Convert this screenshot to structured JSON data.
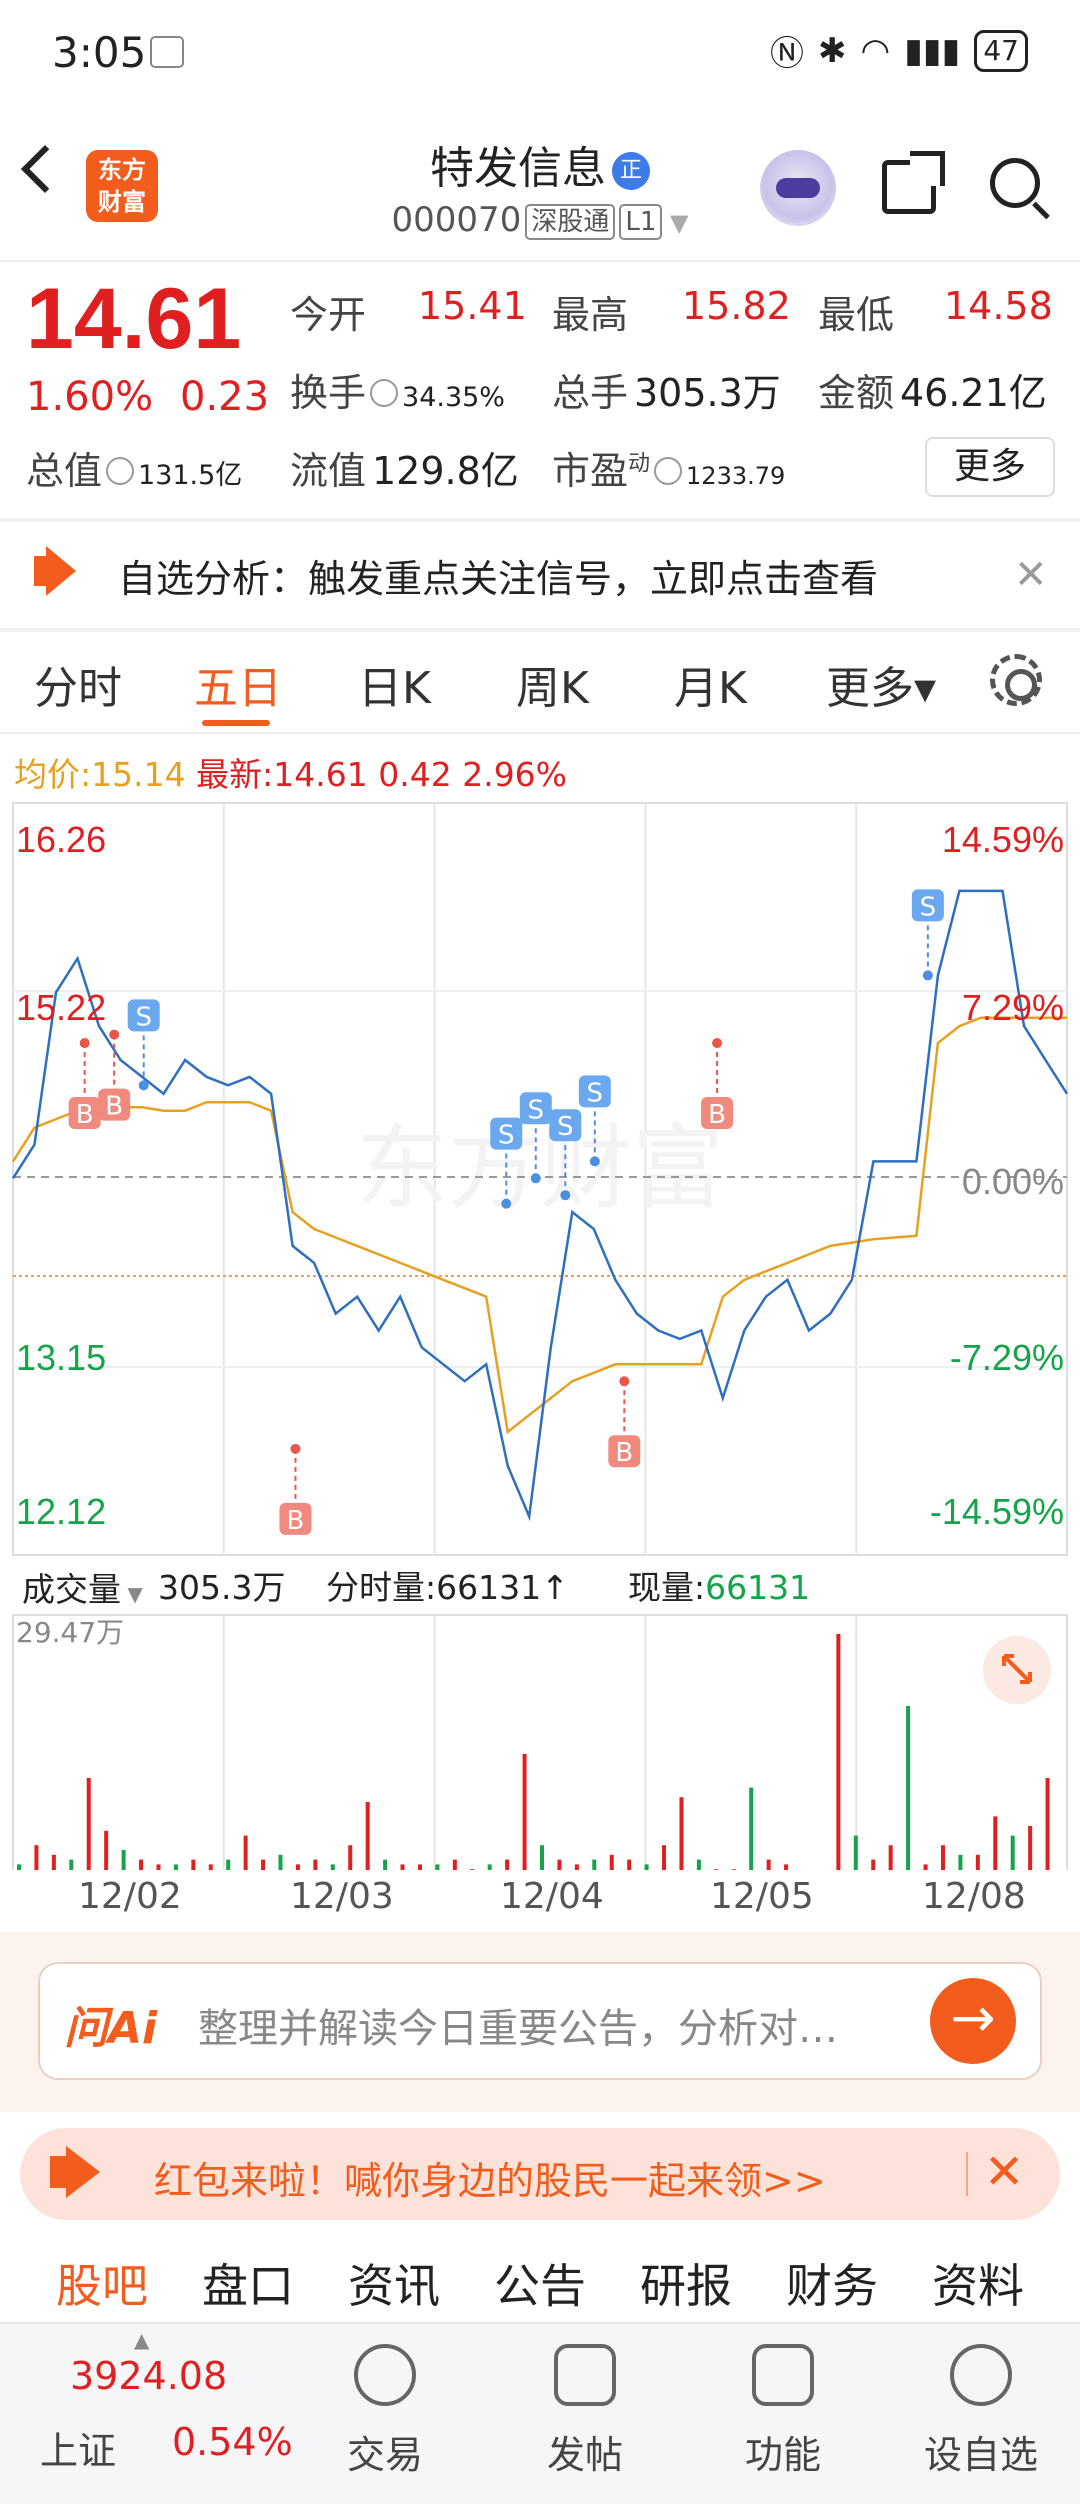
{
  "status_bar": {
    "time": "3:05",
    "battery": "47"
  },
  "header": {
    "logo_line1": "东方",
    "logo_line2": "财富",
    "stock_name": "特发信息",
    "name_badge": "正",
    "stock_code": "000070",
    "tag_connect": "深股通",
    "tag_level": "L1"
  },
  "quote": {
    "price": "14.61",
    "change_pct": "1.60%",
    "change": "0.23",
    "open_label": "今开",
    "open": "15.41",
    "high_label": "最高",
    "high": "15.82",
    "low_label": "最低",
    "low": "14.58",
    "turnover_label": "换手",
    "turnover": "34.35%",
    "volume_label": "总手",
    "volume": "305.3万",
    "amount_label": "金额",
    "amount": "46.21亿",
    "mktcap_label": "总值",
    "mktcap": "131.5亿",
    "float_label": "流值",
    "float": "129.8亿",
    "pe_label": "市盈",
    "pe_sup": "动",
    "pe": "1233.79",
    "more_label": "更多"
  },
  "notice": {
    "text": "自选分析：触发重点关注信号，立即点击查看",
    "close": "✕"
  },
  "tabs": [
    "分时",
    "五日",
    "日K",
    "周K",
    "月K",
    "更多▾"
  ],
  "avg_line": {
    "avg_label": "均价:",
    "avg": "15.14",
    "latest_label": "最新:",
    "latest": "14.61",
    "diff": "0.42",
    "pct": "2.96%"
  },
  "chart_data": {
    "type": "line",
    "title": "",
    "x": [
      "12/02",
      "12/03",
      "12/04",
      "12/05",
      "12/08"
    ],
    "y_labels_left": [
      "16.26",
      "15.22",
      "13.15",
      "12.12"
    ],
    "y_labels_right": [
      "14.59%",
      "7.29%",
      "0.00%",
      "-7.29%",
      "-14.59%"
    ],
    "ylim": [
      12.12,
      16.26
    ],
    "prev_close_label": "0.00%",
    "watermark": "东方财富",
    "signals": [
      {
        "label": "B",
        "day": "12/02",
        "price": 15.0
      },
      {
        "label": "B",
        "day": "12/02",
        "price": 15.05
      },
      {
        "label": "S",
        "day": "12/02",
        "price": 14.75
      },
      {
        "label": "B",
        "day": "12/03",
        "price": 12.6
      },
      {
        "label": "S",
        "day": "12/04",
        "price": 14.05
      },
      {
        "label": "S",
        "day": "12/04",
        "price": 14.2
      },
      {
        "label": "S",
        "day": "12/04",
        "price": 14.1
      },
      {
        "label": "S",
        "day": "12/04",
        "price": 14.3
      },
      {
        "label": "B",
        "day": "12/04",
        "price": 13.0
      },
      {
        "label": "S",
        "day": "12/08",
        "price": 15.4
      },
      {
        "label": "B",
        "day": "12/05",
        "price": 15.0
      }
    ],
    "series": [
      {
        "values": [
          14.2,
          14.4,
          15.3,
          15.5,
          15.1,
          14.9,
          14.8,
          14.7,
          14.9,
          14.8,
          14.75,
          14.8,
          14.7,
          13.8,
          13.7,
          13.4,
          13.5,
          13.3,
          13.5,
          13.2,
          13.1,
          13.0,
          13.1,
          12.5,
          12.2,
          13.2,
          14.0,
          13.9,
          13.6,
          13.4,
          13.3,
          13.25,
          13.3,
          12.9,
          13.3,
          13.5,
          13.6,
          13.3,
          13.4,
          13.6,
          14.3,
          14.3,
          14.3,
          15.4,
          15.9,
          15.9,
          15.9,
          15.1,
          14.9,
          14.7
        ]
      },
      {
        "values": [
          14.3,
          14.5,
          14.55,
          14.6,
          14.6,
          14.62,
          14.62,
          14.6,
          14.6,
          14.65,
          14.65,
          14.65,
          14.6,
          14.0,
          13.9,
          13.85,
          13.8,
          13.75,
          13.7,
          13.65,
          13.6,
          13.55,
          13.5,
          12.7,
          12.8,
          12.9,
          13.0,
          13.05,
          13.1,
          13.1,
          13.1,
          13.1,
          13.1,
          13.5,
          13.6,
          13.65,
          13.7,
          13.75,
          13.8,
          13.82,
          13.84,
          13.85,
          13.86,
          15.0,
          15.1,
          15.15,
          15.15,
          15.15,
          15.15,
          15.15
        ]
      }
    ]
  },
  "volume": {
    "label": "成交量",
    "total": "305.3万",
    "tick_label": "分时量:",
    "tick": "66131↑",
    "now_label": "现量:",
    "now": "66131",
    "max_label": "29.47万",
    "values": [
      2,
      6,
      4,
      3,
      20,
      9,
      5,
      3,
      2,
      2,
      3,
      2,
      3,
      8,
      3,
      4,
      2,
      3,
      2,
      6,
      15,
      3,
      2,
      2,
      2,
      3,
      1,
      2,
      3,
      25,
      6,
      3,
      2,
      3,
      4,
      3,
      2,
      6,
      16,
      3,
      1,
      1,
      18,
      3,
      2,
      0,
      0,
      50,
      8,
      3,
      6,
      35,
      2,
      6,
      4,
      4,
      12,
      8,
      10,
      20
    ]
  },
  "dates": [
    "12/02",
    "12/03",
    "12/04",
    "12/05",
    "12/08"
  ],
  "ai": {
    "logo": "问Ai",
    "placeholder": "整理并解读今日重要公告，分析对…",
    "btn": "→"
  },
  "red_packet": {
    "text": "红包来啦！喊你身边的股民一起来领>>",
    "close": "✕"
  },
  "sub_tabs": [
    "股吧",
    "盘口",
    "资讯",
    "公告",
    "研报",
    "财务",
    "资料"
  ],
  "bottom_bar": {
    "index_value": "3924.08",
    "index_name": "上证",
    "index_pct": "0.54%",
    "items": [
      "交易",
      "发帖",
      "功能",
      "设自选"
    ]
  },
  "colors": {
    "up": "#e02020",
    "down": "#16a34a",
    "accent": "#f25c1c",
    "line": "#2e6fbf",
    "avg": "#e8a020"
  }
}
